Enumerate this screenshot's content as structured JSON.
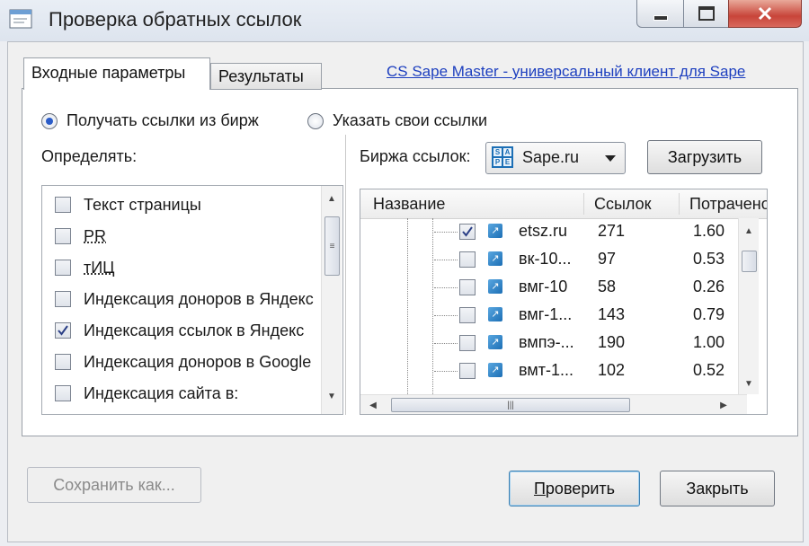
{
  "window": {
    "title": "Проверка обратных ссылок",
    "controls": {
      "minimize_icon": "minimize-icon",
      "maximize_icon": "maximize-icon",
      "close_icon": "close-icon"
    }
  },
  "tabs": [
    {
      "label": "Входные параметры",
      "active": true
    },
    {
      "label": "Результаты",
      "active": false
    }
  ],
  "header_link": "CS Sape Master - универсальный клиент для Sape",
  "source_options": [
    {
      "label": "Получать ссылки из бирж",
      "selected": true
    },
    {
      "label": "Указать свои ссылки",
      "selected": false
    }
  ],
  "determine": {
    "label": "Определять:",
    "items": [
      {
        "label": "Текст страницы",
        "checked": false
      },
      {
        "label": "PR",
        "checked": false
      },
      {
        "label": "тИЦ",
        "checked": false
      },
      {
        "label": "Индексация доноров в Яндекс",
        "checked": false
      },
      {
        "label": "Индексация ссылок в Яндекс",
        "checked": true
      },
      {
        "label": "Индексация доноров в Google",
        "checked": false
      },
      {
        "label": "Индексация сайта в:",
        "checked": false
      }
    ]
  },
  "exchange": {
    "label": "Биржа ссылок:",
    "selected": "Sape.ru",
    "logo_letters": [
      "S",
      "A",
      "P",
      "E"
    ],
    "load_button": "Загрузить"
  },
  "links_table": {
    "columns": [
      "Название",
      "Ссылок",
      "Потрачено"
    ],
    "rows": [
      {
        "name": "etsz.ru",
        "links": "271",
        "spent": "1.60",
        "checked": true
      },
      {
        "name": "вк-10...",
        "links": "97",
        "spent": "0.53",
        "checked": false
      },
      {
        "name": "вмг-10",
        "links": "58",
        "spent": "0.26",
        "checked": false
      },
      {
        "name": "вмг-1...",
        "links": "143",
        "spent": "0.79",
        "checked": false
      },
      {
        "name": "вмпэ-...",
        "links": "190",
        "spent": "1.00",
        "checked": false
      },
      {
        "name": "вмт-1...",
        "links": "102",
        "spent": "0.52",
        "checked": false
      }
    ]
  },
  "buttons": {
    "save_as": "Сохранить как...",
    "check_accel": "П",
    "check_rest": "роверить",
    "close": "Закрыть"
  },
  "colors": {
    "link": "#1d3fbf",
    "titlebar": "#dde4ee",
    "close_button": "#c8453a"
  }
}
